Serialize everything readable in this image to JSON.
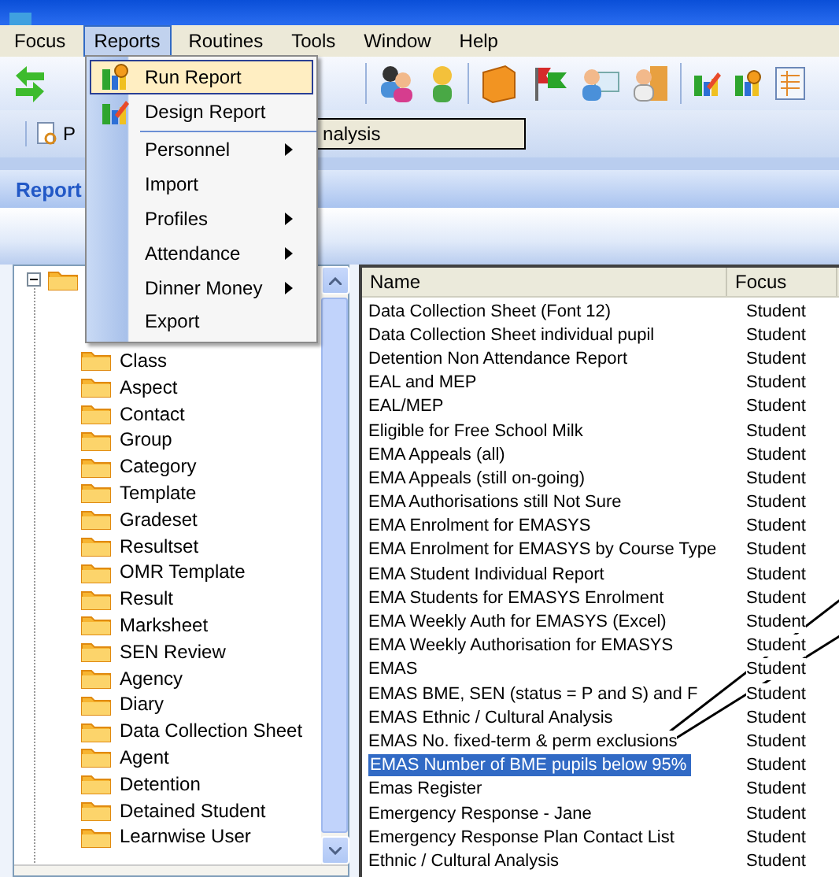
{
  "menu_bar": [
    {
      "label": "Focus",
      "selected": false
    },
    {
      "label": "Reports",
      "selected": true
    },
    {
      "label": "Routines",
      "selected": false
    },
    {
      "label": "Tools",
      "selected": false
    },
    {
      "label": "Window",
      "selected": false
    },
    {
      "label": "Help",
      "selected": false
    }
  ],
  "reports_menu": [
    {
      "kind": "item",
      "label": "Run Report",
      "submenu": false,
      "selected": true
    },
    {
      "kind": "item",
      "label": "Design Report",
      "submenu": false,
      "selected": false
    },
    {
      "kind": "separator"
    },
    {
      "kind": "item",
      "label": "Personnel",
      "submenu": true,
      "selected": false
    },
    {
      "kind": "item",
      "label": "Import",
      "submenu": false,
      "selected": false
    },
    {
      "kind": "item",
      "label": "Profiles",
      "submenu": true,
      "selected": false
    },
    {
      "kind": "item",
      "label": "Attendance",
      "submenu": true,
      "selected": false
    },
    {
      "kind": "item",
      "label": "Dinner Money",
      "submenu": true,
      "selected": false
    },
    {
      "kind": "item",
      "label": "Export",
      "submenu": false,
      "selected": false
    }
  ],
  "report_toolbar": {
    "preview_button": "P",
    "report_field": "nalysis"
  },
  "section_title": "Report",
  "tree": {
    "expanded": true,
    "children": [
      "Class",
      "Aspect",
      "Contact",
      "Group",
      "Category",
      "Template",
      "Gradeset",
      "Resultset",
      "OMR Template",
      "Result",
      "Marksheet",
      "SEN Review",
      "Agency",
      "Diary",
      "Data Collection Sheet",
      "Agent",
      "Detention",
      "Detained Student",
      "Learnwise User"
    ]
  },
  "report_list": {
    "columns": [
      "Name",
      "Focus"
    ],
    "rows": [
      {
        "name": "Data Collection Sheet (Font 12)",
        "focus": "Student",
        "selected": false
      },
      {
        "name": "Data Collection Sheet individual pupil",
        "focus": "Student",
        "selected": false
      },
      {
        "name": "Detention Non Attendance Report",
        "focus": "Student",
        "selected": false
      },
      {
        "name": "EAL and MEP",
        "focus": "Student",
        "selected": false
      },
      {
        "name": "EAL/MEP",
        "focus": "Student",
        "selected": false
      },
      {
        "name": "Eligible for Free School Milk",
        "focus": "Student",
        "selected": false
      },
      {
        "name": "EMA Appeals (all)",
        "focus": "Student",
        "selected": false
      },
      {
        "name": "EMA Appeals (still on-going)",
        "focus": "Student",
        "selected": false
      },
      {
        "name": "EMA Authorisations still Not Sure",
        "focus": "Student",
        "selected": false
      },
      {
        "name": "EMA Enrolment for EMASYS",
        "focus": "Student",
        "selected": false
      },
      {
        "name": "EMA Enrolment for EMASYS by Course Type",
        "focus": "Student",
        "selected": false
      },
      {
        "name": "EMA Student Individual Report",
        "focus": "Student",
        "selected": false
      },
      {
        "name": "EMA Students for EMASYS Enrolment",
        "focus": "Student",
        "selected": false
      },
      {
        "name": "EMA Weekly Auth for EMASYS (Excel)",
        "focus": "Student",
        "selected": false
      },
      {
        "name": "EMA Weekly Authorisation for EMASYS",
        "focus": "Student",
        "selected": false
      },
      {
        "name": "EMAS",
        "focus": "Student",
        "selected": false
      },
      {
        "name": "EMAS BME, SEN (status = P and S) and F",
        "focus": "Student",
        "selected": false
      },
      {
        "name": "EMAS Ethnic / Cultural Analysis",
        "focus": "Student",
        "selected": false
      },
      {
        "name": "EMAS No. fixed-term & perm exclusions",
        "focus": "Student",
        "selected": false
      },
      {
        "name": "EMAS Number of BME pupils below 95%",
        "focus": "Student",
        "selected": true
      },
      {
        "name": "Emas Register",
        "focus": "Student",
        "selected": false
      },
      {
        "name": "Emergency Response - Jane",
        "focus": "Student",
        "selected": false
      },
      {
        "name": "Emergency Response Plan Contact List",
        "focus": "Student",
        "selected": false
      },
      {
        "name": "Ethnic / Cultural Analysis",
        "focus": "Student",
        "selected": false
      }
    ]
  }
}
